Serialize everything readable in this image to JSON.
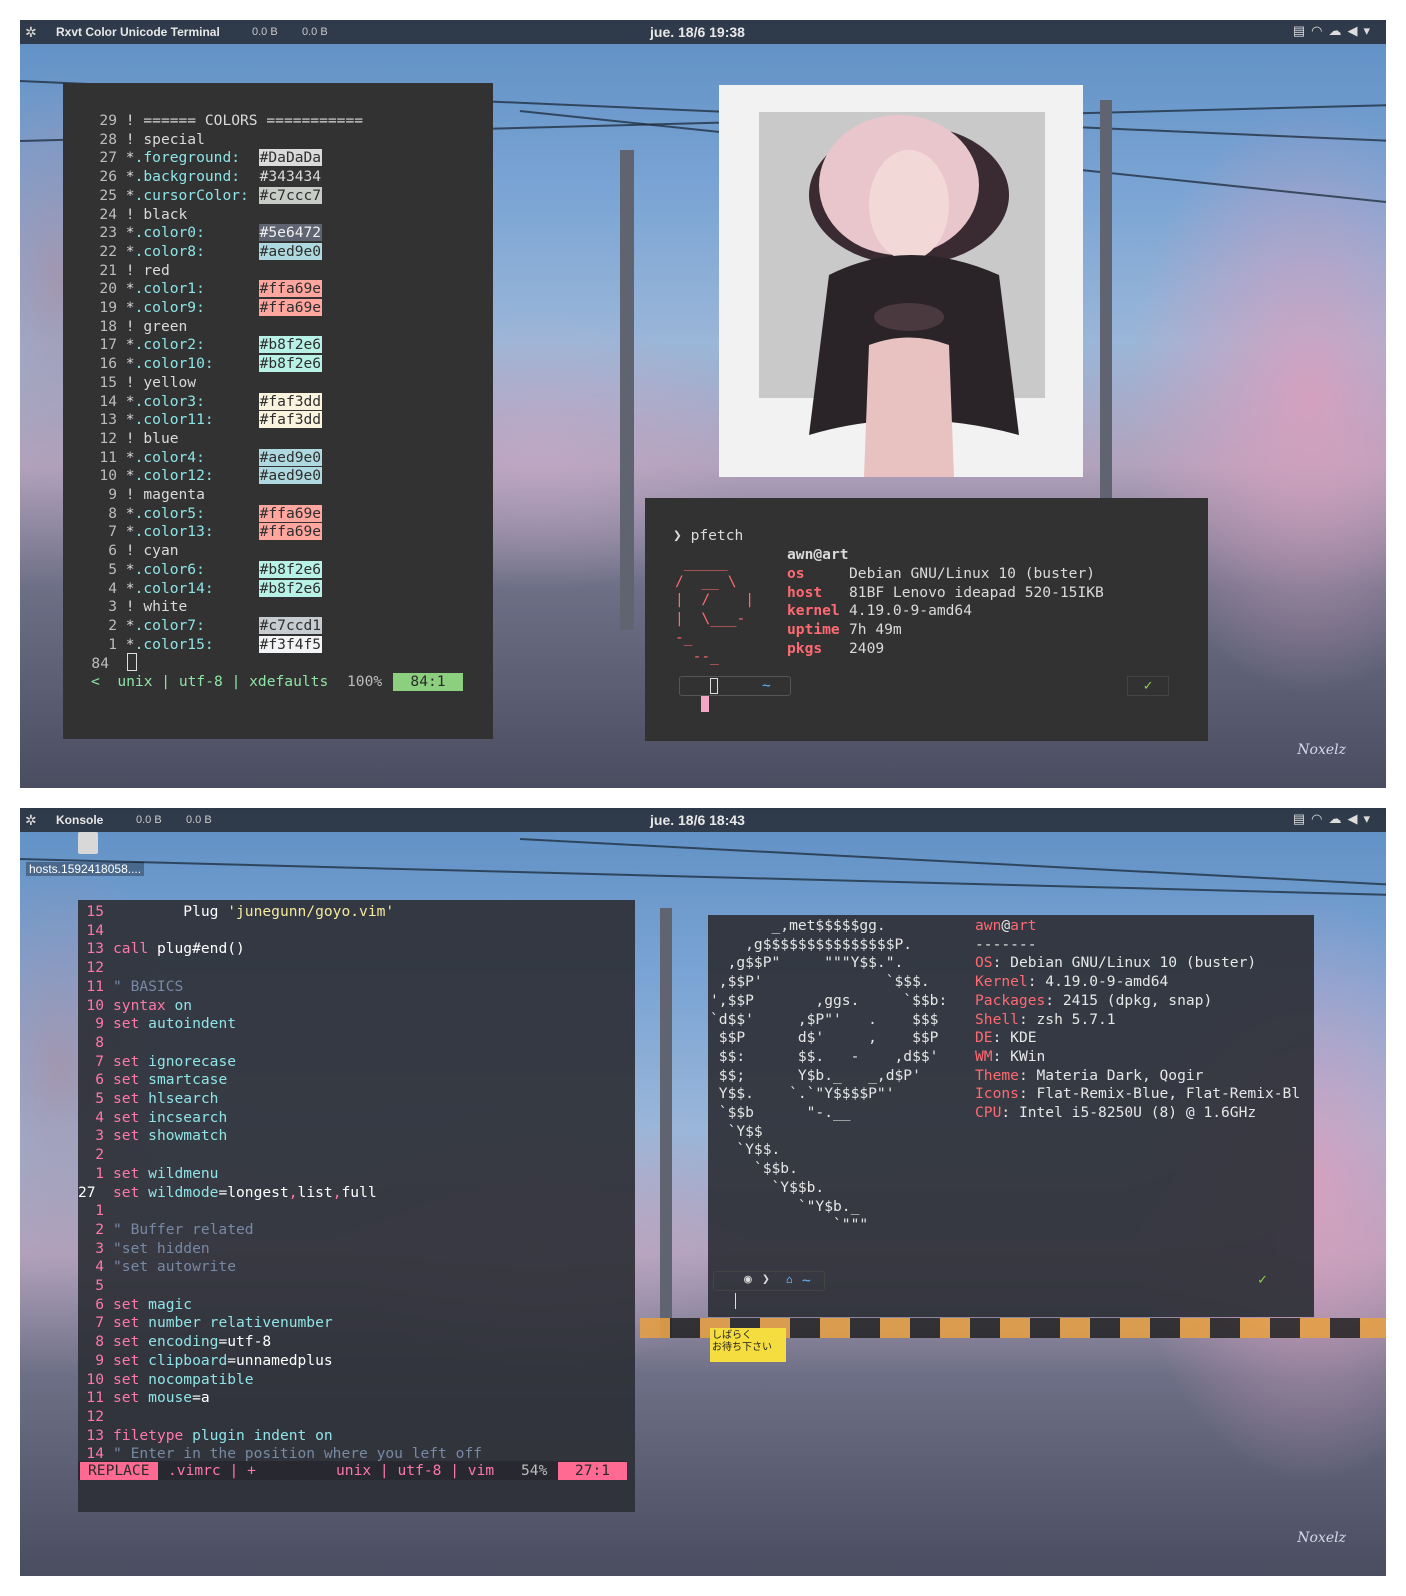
{
  "top": {
    "bar": {
      "app": "Rxvt Color Unicode Terminal",
      "net1": "0.0 B",
      "net2": "0.0 B",
      "clock": "jue. 18/6  19:38"
    },
    "xdefaults_lines": [
      {
        "n": "29",
        "text": "! ====== COLORS ===========",
        "key": "",
        "hex": "",
        "hexbg": ""
      },
      {
        "n": "28",
        "text": "! special",
        "key": "",
        "hex": "",
        "hexbg": ""
      },
      {
        "n": "27",
        "text": "*",
        "key": ".foreground:",
        "hex": "#DaDaDa",
        "hexbg": "#dadada"
      },
      {
        "n": "26",
        "text": "*",
        "key": ".background:",
        "hex": "#343434",
        "hexbg": "#343434"
      },
      {
        "n": "25",
        "text": "*",
        "key": ".cursorColor:",
        "hex": "#c7ccc7",
        "hexbg": "#c7ccc7"
      },
      {
        "n": "24",
        "text": "! black",
        "key": "",
        "hex": "",
        "hexbg": ""
      },
      {
        "n": "23",
        "text": "*",
        "key": ".color0:",
        "hex": "#5e6472",
        "hexbg": "#5e6472"
      },
      {
        "n": "22",
        "text": "*",
        "key": ".color8:",
        "hex": "#aed9e0",
        "hexbg": "#aed9e0"
      },
      {
        "n": "21",
        "text": "! red",
        "key": "",
        "hex": "",
        "hexbg": ""
      },
      {
        "n": "20",
        "text": "*",
        "key": ".color1:",
        "hex": "#ffa69e",
        "hexbg": "#ffa69e"
      },
      {
        "n": "19",
        "text": "*",
        "key": ".color9:",
        "hex": "#ffa69e",
        "hexbg": "#ffa69e"
      },
      {
        "n": "18",
        "text": "! green",
        "key": "",
        "hex": "",
        "hexbg": ""
      },
      {
        "n": "17",
        "text": "*",
        "key": ".color2:",
        "hex": "#b8f2e6",
        "hexbg": "#b8f2e6"
      },
      {
        "n": "16",
        "text": "*",
        "key": ".color10:",
        "hex": "#b8f2e6",
        "hexbg": "#b8f2e6"
      },
      {
        "n": "15",
        "text": "! yellow",
        "key": "",
        "hex": "",
        "hexbg": ""
      },
      {
        "n": "14",
        "text": "*",
        "key": ".color3:",
        "hex": "#faf3dd",
        "hexbg": "#faf3dd"
      },
      {
        "n": "13",
        "text": "*",
        "key": ".color11:",
        "hex": "#faf3dd",
        "hexbg": "#faf3dd"
      },
      {
        "n": "12",
        "text": "! blue",
        "key": "",
        "hex": "",
        "hexbg": ""
      },
      {
        "n": "11",
        "text": "*",
        "key": ".color4:",
        "hex": "#aed9e0",
        "hexbg": "#aed9e0"
      },
      {
        "n": "10",
        "text": "*",
        "key": ".color12:",
        "hex": "#aed9e0",
        "hexbg": "#aed9e0"
      },
      {
        "n": "9",
        "text": "! magenta",
        "key": "",
        "hex": "",
        "hexbg": ""
      },
      {
        "n": "8",
        "text": "*",
        "key": ".color5:",
        "hex": "#ffa69e",
        "hexbg": "#ffa69e"
      },
      {
        "n": "7",
        "text": "*",
        "key": ".color13:",
        "hex": "#ffa69e",
        "hexbg": "#ffa69e"
      },
      {
        "n": "6",
        "text": "! cyan",
        "key": "",
        "hex": "",
        "hexbg": ""
      },
      {
        "n": "5",
        "text": "*",
        "key": ".color6:",
        "hex": "#b8f2e6",
        "hexbg": "#b8f2e6"
      },
      {
        "n": "4",
        "text": "*",
        "key": ".color14:",
        "hex": "#b8f2e6",
        "hexbg": "#b8f2e6"
      },
      {
        "n": "3",
        "text": "! white",
        "key": "",
        "hex": "",
        "hexbg": ""
      },
      {
        "n": "2",
        "text": "*",
        "key": ".color7:",
        "hex": "#c7ccd1",
        "hexbg": "#c7ccd1"
      },
      {
        "n": "1",
        "text": "*",
        "key": ".color15:",
        "hex": "#f3f4f5",
        "hexbg": "#f3f4f5"
      }
    ],
    "current_line": "84",
    "status": {
      "left": "<  unix | utf-8 | xdefaults",
      "pct": "100%",
      "pos": "84:1"
    },
    "pfetch": {
      "prompt": "❯ pfetch",
      "user": "awn",
      "at": "@",
      "host_name": "art",
      "rows": [
        {
          "k": "os",
          "v": "Debian GNU/Linux 10 (buster)"
        },
        {
          "k": "host",
          "v": "81BF Lenovo ideapad 520-15IKB"
        },
        {
          "k": "kernel",
          "v": "4.19.0-9-amd64"
        },
        {
          "k": "uptime",
          "v": "7h 49m"
        },
        {
          "k": "pkgs",
          "v": "2409"
        }
      ],
      "logo": [
        " _____",
        "/  __ \\",
        "|  /    |",
        "|  \\___-",
        "-_",
        "  --_"
      ],
      "tilde": "~",
      "check": "✓"
    },
    "signature": "Noxelz"
  },
  "bottom": {
    "bar": {
      "app": "Konsole",
      "net1": "0.0 B",
      "net2": "0.0 B",
      "clock": "jue. 18/6  18:43"
    },
    "desktop_file": "hosts.1592418058....",
    "vim_lines": [
      {
        "n": "15",
        "parts": [
          [
            "        Plug ",
            "nm"
          ],
          [
            "'junegunn/goyo.vim'",
            "str"
          ]
        ]
      },
      {
        "n": "14",
        "parts": []
      },
      {
        "n": "13",
        "parts": [
          [
            "call ",
            "kw"
          ],
          [
            "plug#end()",
            "nm"
          ]
        ]
      },
      {
        "n": "12",
        "parts": []
      },
      {
        "n": "11",
        "parts": [
          [
            "\" BASICS",
            "cmt"
          ]
        ]
      },
      {
        "n": "10",
        "parts": [
          [
            "syntax ",
            "kw"
          ],
          [
            "on",
            "op"
          ]
        ]
      },
      {
        "n": "9",
        "parts": [
          [
            "set ",
            "kw"
          ],
          [
            "autoindent",
            "op"
          ]
        ]
      },
      {
        "n": "8",
        "parts": []
      },
      {
        "n": "7",
        "parts": [
          [
            "set ",
            "kw"
          ],
          [
            "ignorecase",
            "op"
          ]
        ]
      },
      {
        "n": "6",
        "parts": [
          [
            "set ",
            "kw"
          ],
          [
            "smartcase",
            "op"
          ]
        ]
      },
      {
        "n": "5",
        "parts": [
          [
            "set ",
            "kw"
          ],
          [
            "hlsearch",
            "op"
          ]
        ]
      },
      {
        "n": "4",
        "parts": [
          [
            "set ",
            "kw"
          ],
          [
            "incsearch",
            "op"
          ]
        ]
      },
      {
        "n": "3",
        "parts": [
          [
            "set ",
            "kw"
          ],
          [
            "showmatch",
            "op"
          ]
        ]
      },
      {
        "n": "2",
        "parts": []
      },
      {
        "n": "1",
        "parts": [
          [
            "set ",
            "kw"
          ],
          [
            "wildmenu",
            "op"
          ]
        ]
      },
      {
        "n": "27",
        "parts": [
          [
            "set ",
            "kw"
          ],
          [
            "wildmode",
            "op"
          ],
          [
            "=longest",
            "nm"
          ],
          [
            ",",
            "kw"
          ],
          [
            "list",
            "nm"
          ],
          [
            ",",
            "kw"
          ],
          [
            "full",
            "nm"
          ]
        ],
        "cur": true
      },
      {
        "n": "1",
        "parts": []
      },
      {
        "n": "2",
        "parts": [
          [
            "\" Buffer related",
            "cmt"
          ]
        ]
      },
      {
        "n": "3",
        "parts": [
          [
            "\"set hidden",
            "cmt"
          ]
        ]
      },
      {
        "n": "4",
        "parts": [
          [
            "\"set autowrite",
            "cmt"
          ]
        ]
      },
      {
        "n": "5",
        "parts": []
      },
      {
        "n": "6",
        "parts": [
          [
            "set ",
            "kw"
          ],
          [
            "magic",
            "op"
          ]
        ]
      },
      {
        "n": "7",
        "parts": [
          [
            "set ",
            "kw"
          ],
          [
            "number relativenumber",
            "op"
          ]
        ]
      },
      {
        "n": "8",
        "parts": [
          [
            "set ",
            "kw"
          ],
          [
            "encoding",
            "op"
          ],
          [
            "=utf-8",
            "nm"
          ]
        ]
      },
      {
        "n": "9",
        "parts": [
          [
            "set ",
            "kw"
          ],
          [
            "clipboard",
            "op"
          ],
          [
            "=unnamedplus",
            "nm"
          ]
        ]
      },
      {
        "n": "10",
        "parts": [
          [
            "set ",
            "kw"
          ],
          [
            "nocompatible",
            "op"
          ]
        ]
      },
      {
        "n": "11",
        "parts": [
          [
            "set ",
            "kw"
          ],
          [
            "mouse",
            "op"
          ],
          [
            "=a",
            "nm"
          ]
        ]
      },
      {
        "n": "12",
        "parts": []
      },
      {
        "n": "13",
        "parts": [
          [
            "filetype ",
            "kw"
          ],
          [
            "plugin indent on",
            "op"
          ]
        ]
      },
      {
        "n": "14",
        "parts": [
          [
            "\" Enter in the position where you left off",
            "cmt"
          ]
        ]
      }
    ],
    "vim_status": {
      "mode": "REPLACE",
      "file": ".vimrc | +",
      "info": "unix | utf-8 | vim",
      "pct": "54%",
      "pos": "27:1"
    },
    "neofetch": {
      "ascii": [
        "       _,met$$$$$gg.",
        "    ,g$$$$$$$$$$$$$$$P.",
        "  ,g$$P\"     \"\"\"Y$$.\".",
        " ,$$P'              `$$$.",
        "',$$P       ,ggs.     `$$b:",
        "`d$$'     ,$P\"'   .    $$$",
        " $$P      d$'     ,    $$P",
        " $$:      $$.   -    ,d$$'",
        " $$;      Y$b._   _,d$P'",
        " Y$$.    `.`\"Y$$$$P\"'",
        " `$$b      \"-.__",
        "  `Y$$",
        "   `Y$$.",
        "     `$$b.",
        "       `Y$$b.",
        "          `\"Y$b._",
        "              `\"\"\""
      ],
      "user": "awn",
      "at": "@",
      "host_name": "art",
      "sep": "-------",
      "rows": [
        {
          "k": "OS",
          "v": "Debian GNU/Linux 10 (buster)"
        },
        {
          "k": "Kernel",
          "v": "4.19.0-9-amd64"
        },
        {
          "k": "Packages",
          "v": "2415 (dpkg, snap)"
        },
        {
          "k": "Shell",
          "v": "zsh 5.7.1"
        },
        {
          "k": "DE",
          "v": "KDE"
        },
        {
          "k": "WM",
          "v": "KWin"
        },
        {
          "k": "Theme",
          "v": "Materia Dark, Qogir"
        },
        {
          "k": "Icons",
          "v": "Flat-Remix-Blue, Flat-Remix-Bl"
        },
        {
          "k": "CPU",
          "v": "Intel i5-8250U (8) @ 1.6GHz"
        }
      ],
      "tilde": "~",
      "check": "✓"
    },
    "sign": "しばらく\nお待ち下さい",
    "signature": "Noxelz"
  }
}
